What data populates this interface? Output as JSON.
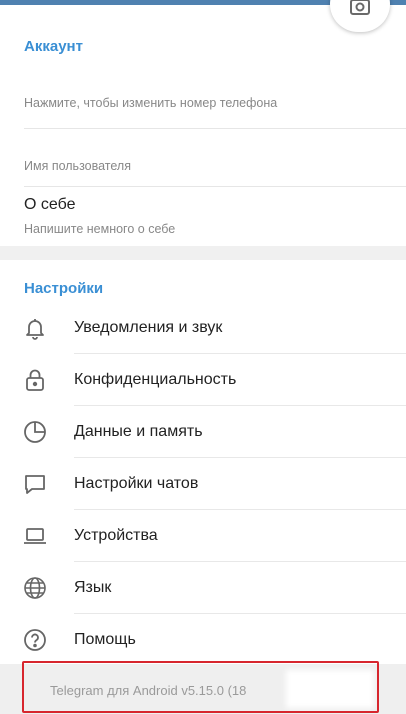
{
  "account": {
    "title": "Аккаунт",
    "phone_hint": "Нажмите, чтобы изменить номер телефона",
    "username_label": "Имя пользователя",
    "bio_title": "О себе",
    "bio_hint": "Напишите немного о себе"
  },
  "settings": {
    "title": "Настройки",
    "items": [
      {
        "label": "Уведомления и звук",
        "icon": "bell-icon"
      },
      {
        "label": "Конфиденциальность",
        "icon": "lock-icon"
      },
      {
        "label": "Данные и память",
        "icon": "pie-chart-icon"
      },
      {
        "label": "Настройки чатов",
        "icon": "chat-bubble-icon"
      },
      {
        "label": "Устройства",
        "icon": "laptop-icon"
      },
      {
        "label": "Язык",
        "icon": "globe-icon"
      },
      {
        "label": "Помощь",
        "icon": "help-icon"
      }
    ]
  },
  "footer": {
    "version": "Telegram для Android v5.15.0 (18"
  },
  "colors": {
    "accent": "#3a8fd4",
    "highlight": "#d7262e",
    "header_strip": "#4f81b0"
  }
}
